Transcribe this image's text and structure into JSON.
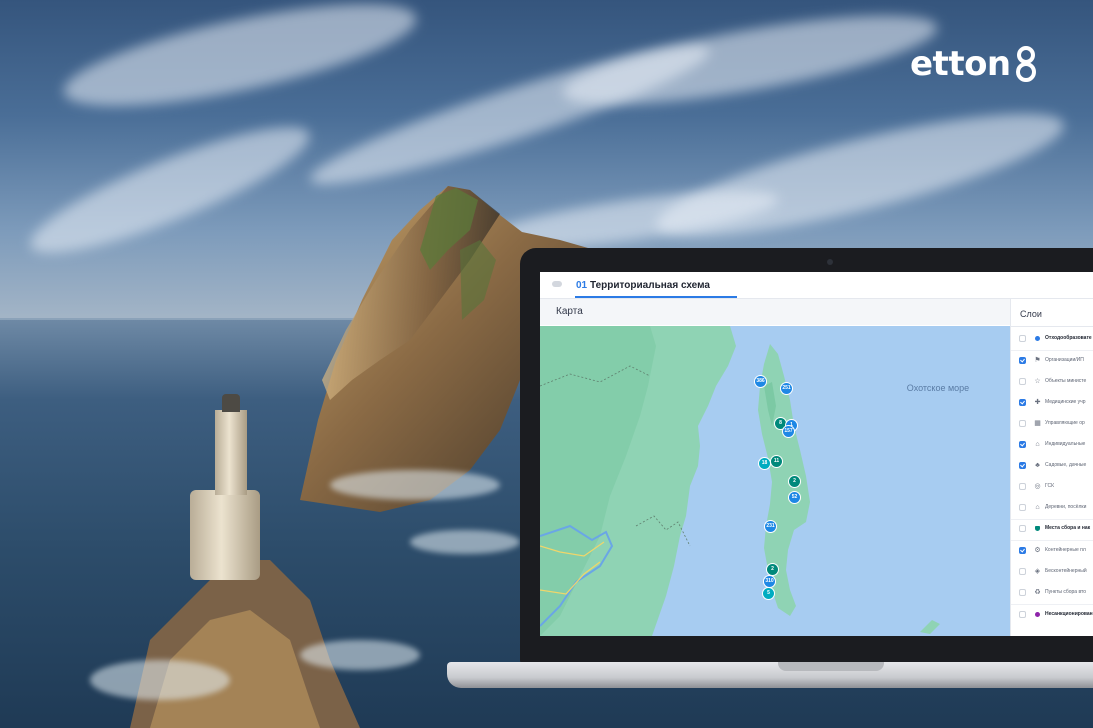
{
  "brand": {
    "logo_text": "etton"
  },
  "app": {
    "tab_number": "01",
    "tab_title": "Территориальная схема"
  },
  "map": {
    "label": "Карта",
    "sea_label": "Охотское море",
    "markers": [
      {
        "text": "386",
        "color": "#1e88e5"
      },
      {
        "text": "251",
        "color": "#1e88e5"
      },
      {
        "text": "8",
        "color": "#00897b"
      },
      {
        "text": "1",
        "color": "#1e88e5"
      },
      {
        "text": "157",
        "color": "#1e88e5"
      },
      {
        "text": "18",
        "color": "#00acc1"
      },
      {
        "text": "11",
        "color": "#00897b"
      },
      {
        "text": "2",
        "color": "#00897b"
      },
      {
        "text": "52",
        "color": "#1e88e5"
      },
      {
        "text": "231",
        "color": "#1e88e5"
      },
      {
        "text": "2",
        "color": "#00897b"
      },
      {
        "text": "310",
        "color": "#1e88e5"
      },
      {
        "text": "5",
        "color": "#00acc1"
      }
    ]
  },
  "layers": {
    "title": "Слои",
    "items": [
      {
        "label": "Отходообразовате",
        "checked": false,
        "icon": "dot",
        "dot_color": "#2c7be5",
        "group": true
      },
      {
        "label": "Организации/ИП",
        "checked": true,
        "icon": "flag-icon",
        "group": false
      },
      {
        "label": "Объекты министе",
        "checked": false,
        "icon": "star-icon",
        "group": false
      },
      {
        "label": "Медицинские учр",
        "checked": true,
        "icon": "medical-icon",
        "group": false
      },
      {
        "label": "Управляющие ор",
        "checked": false,
        "icon": "building-icon",
        "group": false
      },
      {
        "label": "Индивидуальные",
        "checked": true,
        "icon": "house-icon",
        "group": false
      },
      {
        "label": "Садовые, дачные",
        "checked": true,
        "icon": "tree-icon",
        "group": false
      },
      {
        "label": "ГСК",
        "checked": false,
        "icon": "garage-icon",
        "group": false
      },
      {
        "label": "Деревни, посёлки",
        "checked": false,
        "icon": "village-icon",
        "group": false
      },
      {
        "label": "Места сбора и нак",
        "checked": false,
        "icon": "shield",
        "dot_color": "#00897b",
        "group": true
      },
      {
        "label": "Контейнерные пл",
        "checked": true,
        "icon": "container-icon",
        "group": false
      },
      {
        "label": "Бесконтейнерный",
        "checked": false,
        "icon": "bin-icon",
        "group": false
      },
      {
        "label": "Пункты сбора вто",
        "checked": false,
        "icon": "recycle-icon",
        "group": false
      },
      {
        "label": "Несанкционирован",
        "checked": false,
        "icon": "dot",
        "dot_color": "#8e24aa",
        "group": true
      }
    ]
  }
}
